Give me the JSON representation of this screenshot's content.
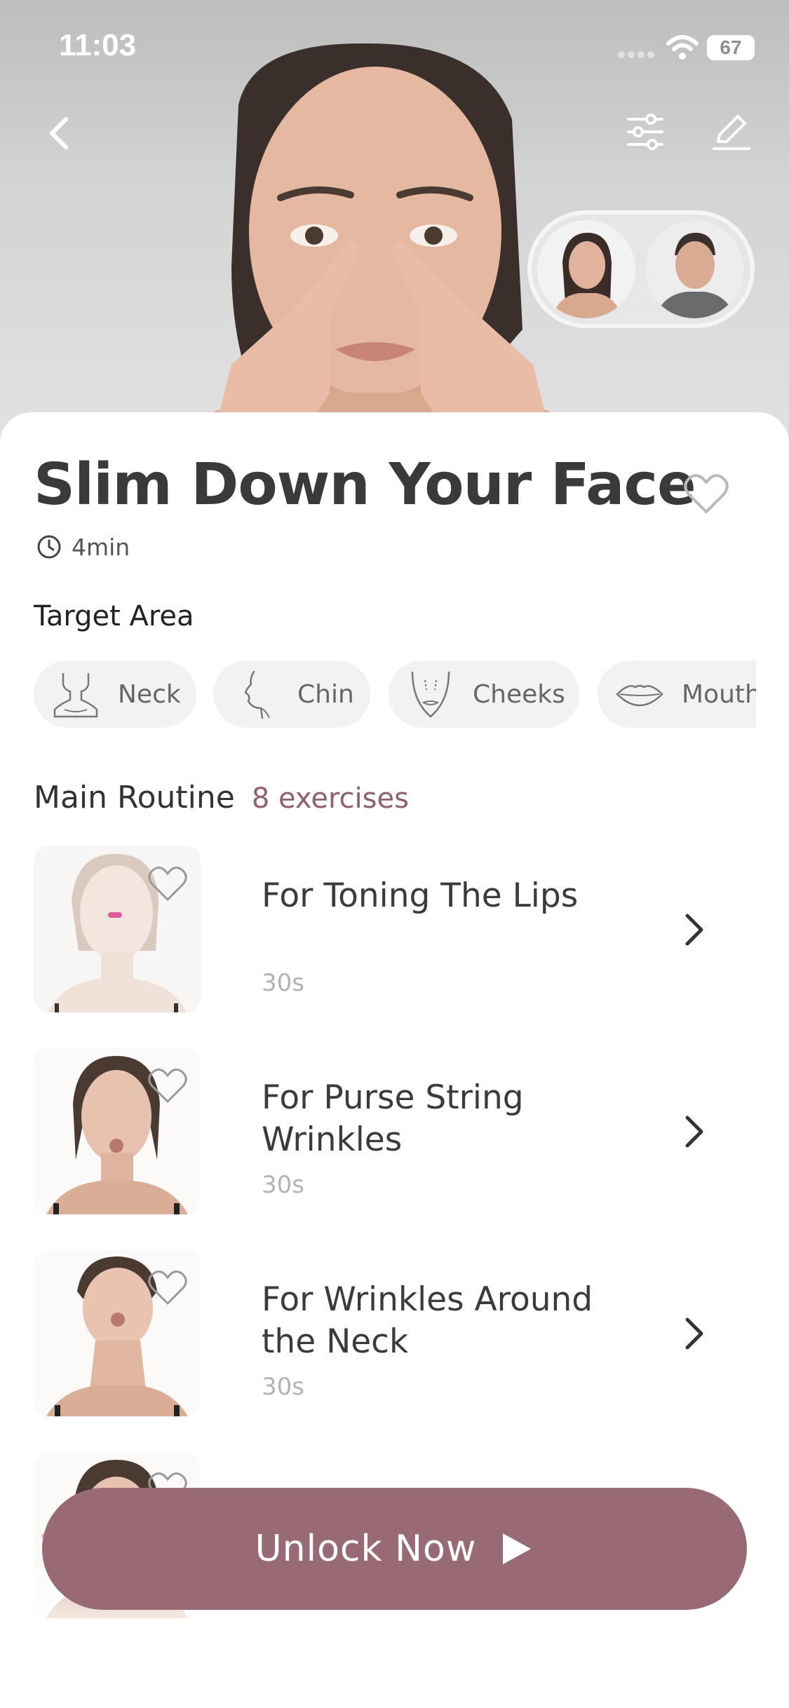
{
  "status_bar": {
    "time": "11:03",
    "battery": "67"
  },
  "header": {
    "back_icon": "chevron-left-icon",
    "filter_icon": "sliders-icon",
    "edit_icon": "pencil-icon",
    "model_options": [
      "female-model",
      "male-model"
    ]
  },
  "workout": {
    "title": "Slim Down Your Face",
    "duration": "4min"
  },
  "target_area": {
    "label": "Target Area",
    "items": [
      {
        "label": "Neck",
        "icon": "neck-icon"
      },
      {
        "label": "Chin",
        "icon": "chin-icon"
      },
      {
        "label": "Cheeks",
        "icon": "cheeks-icon"
      },
      {
        "label": "Mouth",
        "icon": "mouth-icon"
      }
    ]
  },
  "routine": {
    "title": "Main Routine",
    "count": "8 exercises",
    "exercises": [
      {
        "title": "For Toning The Lips",
        "duration": "30s"
      },
      {
        "title": "For Purse String Wrinkles",
        "duration": "30s"
      },
      {
        "title": "For Wrinkles Around the Neck",
        "duration": "30s"
      }
    ]
  },
  "cta": {
    "label": "Unlock Now"
  },
  "colors": {
    "accent": "#986a76",
    "accent_text": "#8f6170",
    "chip_bg": "#f2f2f2"
  }
}
